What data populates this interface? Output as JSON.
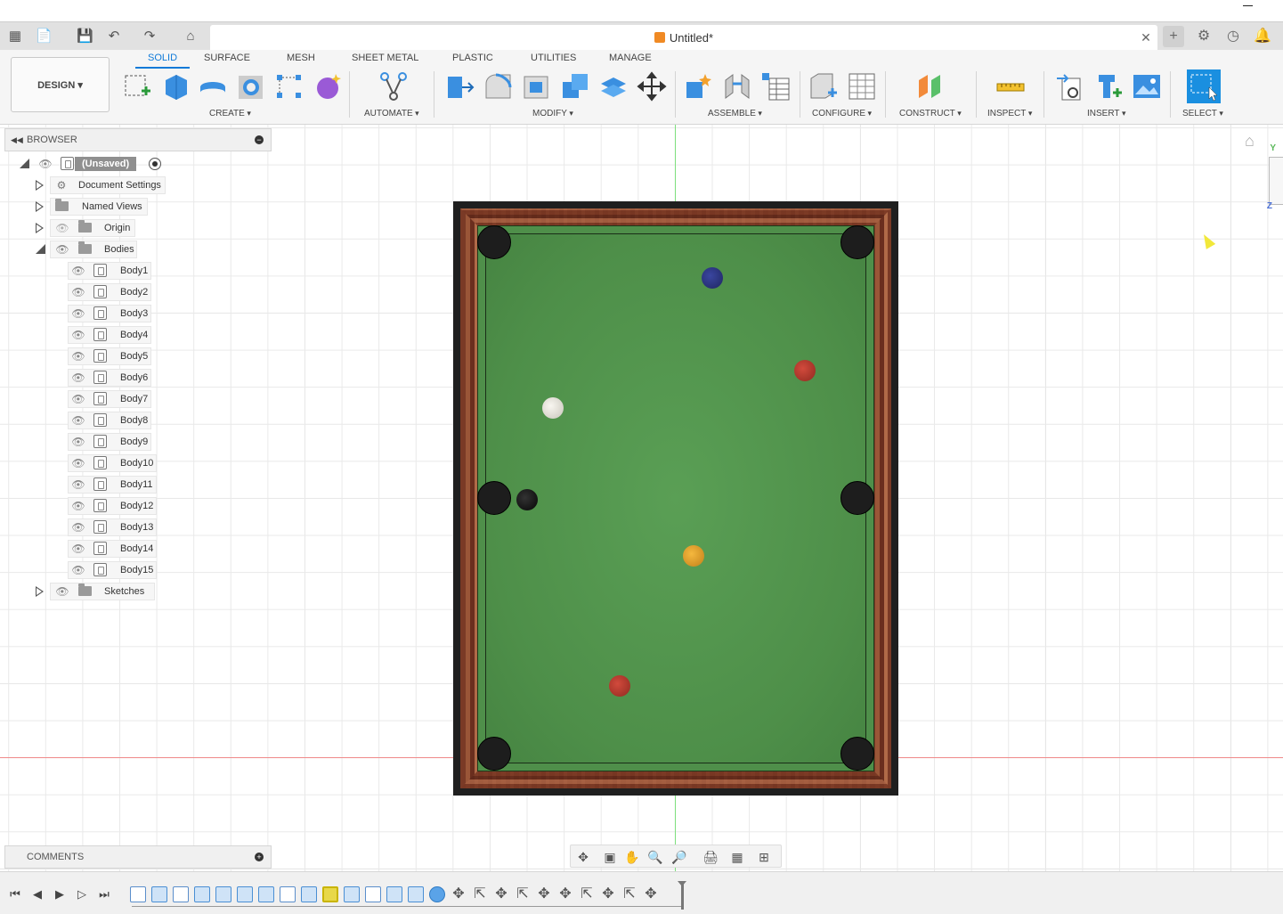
{
  "tabbar": {
    "document_title": "Untitled*"
  },
  "ribbon": {
    "workspace": "DESIGN",
    "tabs": [
      "SOLID",
      "SURFACE",
      "MESH",
      "SHEET METAL",
      "PLASTIC",
      "UTILITIES",
      "MANAGE"
    ],
    "groups": [
      "CREATE",
      "AUTOMATE",
      "MODIFY",
      "ASSEMBLE",
      "CONFIGURE",
      "CONSTRUCT",
      "INSPECT",
      "INSERT",
      "SELECT"
    ]
  },
  "browser": {
    "title": "BROWSER",
    "root": "(Unsaved)",
    "items": [
      "Document Settings",
      "Named Views",
      "Origin",
      "Bodies"
    ],
    "bodies": [
      "Body1",
      "Body2",
      "Body3",
      "Body4",
      "Body5",
      "Body6",
      "Body7",
      "Body8",
      "Body9",
      "Body10",
      "Body11",
      "Body12",
      "Body13",
      "Body14",
      "Body15"
    ],
    "sketches": "Sketches"
  },
  "comments": {
    "title": "COMMENTS"
  },
  "viewcube": {
    "y_label": "Y",
    "z_label": "Z"
  },
  "colors": {
    "accent": "#0f7ad8",
    "felt": "#4f8f4a",
    "pocket": "#1d1d1d",
    "ball_blue": "#2a3580",
    "ball_red": "#b8372a",
    "ball_white": "#e9e6df",
    "ball_black": "#111111",
    "ball_yellow": "#e8a22a"
  }
}
